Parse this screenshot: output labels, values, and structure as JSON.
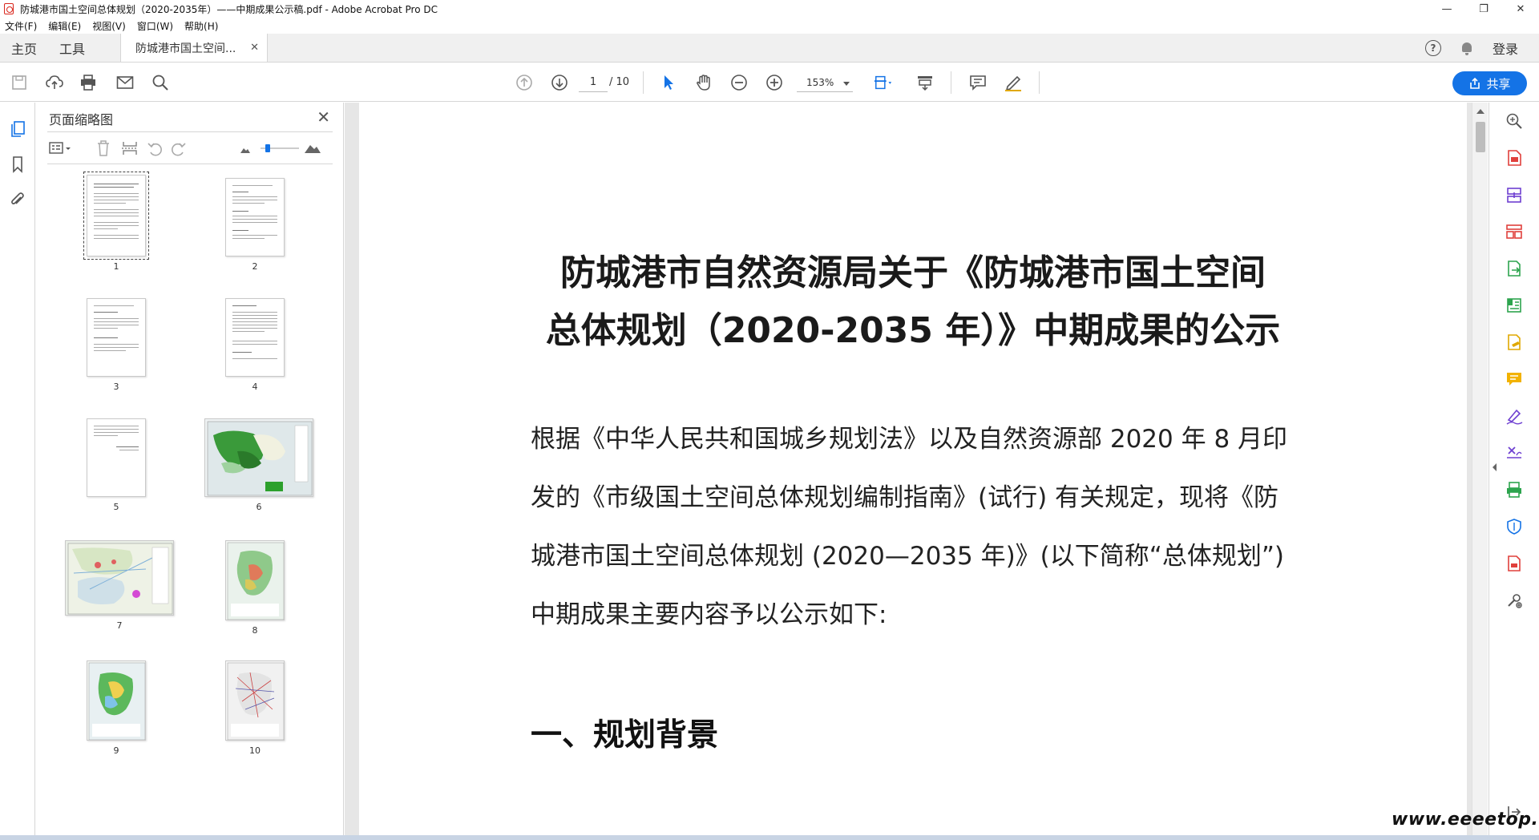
{
  "window": {
    "title": "防城港市国土空间总体规划（2020-2035年）——中期成果公示稿.pdf - Adobe Acrobat Pro DC",
    "controls": [
      "—",
      "❐",
      "✕"
    ]
  },
  "menu": [
    "文件(F)",
    "编辑(E)",
    "视图(V)",
    "窗口(W)",
    "帮助(H)"
  ],
  "tabs": {
    "home": "主页",
    "tools": "工具",
    "document": "防城港市国土空间...",
    "login": "登录"
  },
  "toolbar": {
    "current_page": "1",
    "total_pages": "/ 10",
    "zoom": "153%",
    "share_label": "共享"
  },
  "panel": {
    "title": "页面缩略图",
    "thumbnails": [
      "1",
      "2",
      "3",
      "4",
      "5",
      "6",
      "7",
      "8",
      "9",
      "10"
    ]
  },
  "document": {
    "title_line1": "防城港市自然资源局关于《防城港市国土空间",
    "title_line2": "总体规划（2020-2035 年）》中期成果的公示",
    "para_line1": "根据《中华人民共和国城乡规划法》以及自然资源部 2020 年 8 月印",
    "para_line2": "发的《市级国土空间总体规划编制指南》(试行) 有关规定，现将《防",
    "para_line3": "城港市国土空间总体规划 (2020—2035 年)》(以下简称“总体规划”)",
    "para_line4": "中期成果主要内容予以公示如下:",
    "heading1": "一、规划背景"
  },
  "watermark": "www.eeeetop.com",
  "colors": {
    "accent": "#1473e6",
    "tool_red": "#e0403c",
    "tool_blue": "#1473e6",
    "tool_green": "#2da44e",
    "tool_yellow": "#f2b200",
    "tool_purple": "#6e3fd1"
  }
}
